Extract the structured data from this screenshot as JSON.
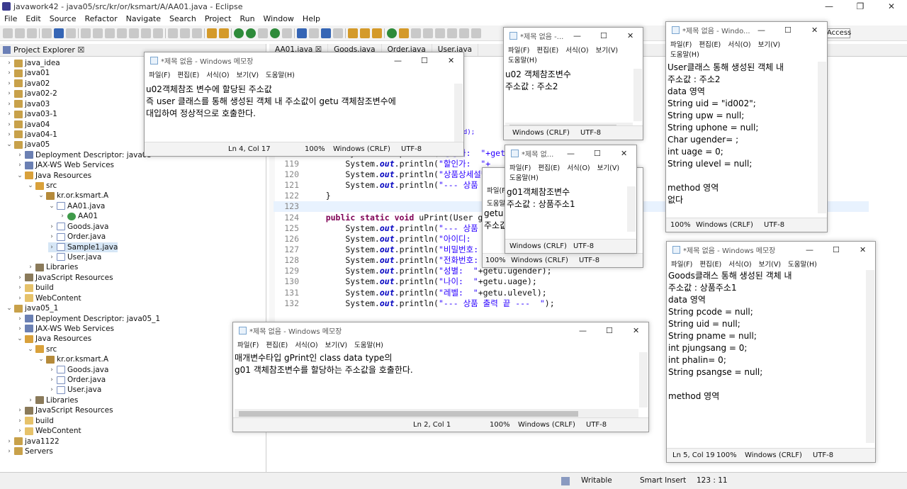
{
  "window": {
    "title": "javawork42 - java05/src/kr/or/ksmart/A/AA01.java - Eclipse"
  },
  "menu": [
    "File",
    "Edit",
    "Source",
    "Refactor",
    "Navigate",
    "Search",
    "Project",
    "Run",
    "Window",
    "Help"
  ],
  "toolbar": {
    "quick_access": "Access"
  },
  "explorer": {
    "title": "Project Explorer ☒"
  },
  "tree": [
    {
      "t": "java_idea",
      "d": 0,
      "tw": "›",
      "ic": "proj"
    },
    {
      "t": "java01",
      "d": 0,
      "tw": "›",
      "ic": "proj"
    },
    {
      "t": "java02",
      "d": 0,
      "tw": "›",
      "ic": "proj"
    },
    {
      "t": "java02-2",
      "d": 0,
      "tw": "›",
      "ic": "proj"
    },
    {
      "t": "java03",
      "d": 0,
      "tw": "›",
      "ic": "proj"
    },
    {
      "t": "java03-1",
      "d": 0,
      "tw": "›",
      "ic": "proj"
    },
    {
      "t": "java04",
      "d": 0,
      "tw": "›",
      "ic": "proj"
    },
    {
      "t": "java04-1",
      "d": 0,
      "tw": "›",
      "ic": "proj"
    },
    {
      "t": "java05",
      "d": 0,
      "tw": "⌄",
      "ic": "proj"
    },
    {
      "t": "Deployment Descriptor: java05",
      "d": 1,
      "tw": "›",
      "ic": "cfg"
    },
    {
      "t": "JAX-WS Web Services",
      "d": 1,
      "tw": "›",
      "ic": "cfg"
    },
    {
      "t": "Java Resources",
      "d": 1,
      "tw": "⌄",
      "ic": "src"
    },
    {
      "t": "src",
      "d": 2,
      "tw": "⌄",
      "ic": "src"
    },
    {
      "t": "kr.or.ksmart.A",
      "d": 3,
      "tw": "⌄",
      "ic": "pkg"
    },
    {
      "t": "AA01.java",
      "d": 4,
      "tw": "⌄",
      "ic": "java"
    },
    {
      "t": "AA01",
      "d": 5,
      "tw": "›",
      "ic": "cls"
    },
    {
      "t": "Goods.java",
      "d": 4,
      "tw": "›",
      "ic": "java"
    },
    {
      "t": "Order.java",
      "d": 4,
      "tw": "›",
      "ic": "java"
    },
    {
      "t": "Sample1.java",
      "d": 4,
      "tw": "›",
      "ic": "java",
      "sel": true
    },
    {
      "t": "User.java",
      "d": 4,
      "tw": "›",
      "ic": "java"
    },
    {
      "t": "Libraries",
      "d": 2,
      "tw": "›",
      "ic": "lib"
    },
    {
      "t": "JavaScript Resources",
      "d": 1,
      "tw": "›",
      "ic": "lib"
    },
    {
      "t": "build",
      "d": 1,
      "tw": "›",
      "ic": "fold"
    },
    {
      "t": "WebContent",
      "d": 1,
      "tw": "›",
      "ic": "fold"
    },
    {
      "t": "java05_1",
      "d": 0,
      "tw": "⌄",
      "ic": "proj"
    },
    {
      "t": "Deployment Descriptor: java05_1",
      "d": 1,
      "tw": "›",
      "ic": "cfg"
    },
    {
      "t": "JAX-WS Web Services",
      "d": 1,
      "tw": "›",
      "ic": "cfg"
    },
    {
      "t": "Java Resources",
      "d": 1,
      "tw": "⌄",
      "ic": "src"
    },
    {
      "t": "src",
      "d": 2,
      "tw": "⌄",
      "ic": "src"
    },
    {
      "t": "kr.or.ksmart.A",
      "d": 3,
      "tw": "⌄",
      "ic": "pkg"
    },
    {
      "t": "Goods.java",
      "d": 4,
      "tw": "›",
      "ic": "java"
    },
    {
      "t": "Order.java",
      "d": 4,
      "tw": "›",
      "ic": "java"
    },
    {
      "t": "User.java",
      "d": 4,
      "tw": "›",
      "ic": "java"
    },
    {
      "t": "Libraries",
      "d": 2,
      "tw": "›",
      "ic": "lib"
    },
    {
      "t": "JavaScript Resources",
      "d": 1,
      "tw": "›",
      "ic": "lib"
    },
    {
      "t": "build",
      "d": 1,
      "tw": "›",
      "ic": "fold"
    },
    {
      "t": "WebContent",
      "d": 1,
      "tw": "›",
      "ic": "fold"
    },
    {
      "t": "java1122",
      "d": 0,
      "tw": "›",
      "ic": "proj"
    },
    {
      "t": "Servers",
      "d": 0,
      "tw": "›",
      "ic": "proj"
    }
  ],
  "editor_tabs": [
    "AA01.java ☒",
    "Goods.java",
    "Order.java",
    "User.java"
  ],
  "code": [
    {
      "n": "",
      "seg": [
        [
          "t",
          "                         "
        ],
        [
          "kr",
          "ods getg"
        ]
      ]
    },
    {
      "n": "",
      "seg": [
        [
          "t",
          "                         "
        ],
        [
          "s",
          "\"+getg"
        ]
      ]
    },
    {
      "n": "",
      "seg": [
        [
          "t",
          "                         "
        ],
        [
          "kr",
          "\"+getg.uid);"
        ]
      ]
    },
    {
      "n": "117",
      "seg": [
        [
          "t",
          "                         "
        ],
        [
          "s",
          "\"+getg."
        ]
      ]
    },
    {
      "n": "118",
      "seg": [
        [
          "t",
          "        System."
        ],
        [
          "f",
          "out"
        ],
        [
          "t",
          ".println("
        ],
        [
          "s",
          "\"정상가:  \"+getg."
        ]
      ]
    },
    {
      "n": "119",
      "seg": [
        [
          "t",
          "        System."
        ],
        [
          "f",
          "out"
        ],
        [
          "t",
          ".println("
        ],
        [
          "s",
          "\"할인가:  \"+"
        ]
      ]
    },
    {
      "n": "120",
      "seg": [
        [
          "t",
          "        System."
        ],
        [
          "f",
          "out"
        ],
        [
          "t",
          ".println("
        ],
        [
          "s",
          "\"상품상세설명"
        ]
      ]
    },
    {
      "n": "121",
      "seg": [
        [
          "t",
          "        System."
        ],
        [
          "f",
          "out"
        ],
        [
          "t",
          ".println("
        ],
        [
          "s",
          "\"--- 상품 "
        ]
      ]
    },
    {
      "n": "122",
      "seg": [
        [
          "t",
          "    }"
        ]
      ]
    },
    {
      "n": "123",
      "seg": [
        [
          "t",
          ""
        ]
      ]
    },
    {
      "n": "124",
      "seg": [
        [
          "t",
          "    "
        ],
        [
          "k",
          "public static void"
        ],
        [
          "t",
          " uPrint(User g"
        ]
      ]
    },
    {
      "n": "125",
      "seg": [
        [
          "t",
          "        System."
        ],
        [
          "f",
          "out"
        ],
        [
          "t",
          ".println("
        ],
        [
          "s",
          "\"--- 상품 출"
        ]
      ]
    },
    {
      "n": "126",
      "seg": [
        [
          "t",
          "        System."
        ],
        [
          "f",
          "out"
        ],
        [
          "t",
          ".println("
        ],
        [
          "s",
          "\"아이디:  \""
        ],
        [
          "t",
          "+"
        ]
      ]
    },
    {
      "n": "127",
      "seg": [
        [
          "t",
          "        System."
        ],
        [
          "f",
          "out"
        ],
        [
          "t",
          ".println("
        ],
        [
          "s",
          "\"비밀번호:  \""
        ]
      ]
    },
    {
      "n": "128",
      "seg": [
        [
          "t",
          "        System."
        ],
        [
          "f",
          "out"
        ],
        [
          "t",
          ".println("
        ],
        [
          "s",
          "\"전화번호:  \""
        ],
        [
          "t",
          "+getu.uphone);"
        ]
      ]
    },
    {
      "n": "129",
      "seg": [
        [
          "t",
          "        System."
        ],
        [
          "f",
          "out"
        ],
        [
          "t",
          ".println("
        ],
        [
          "s",
          "\"성별:  \""
        ],
        [
          "t",
          "+getu.ugender);"
        ]
      ]
    },
    {
      "n": "130",
      "seg": [
        [
          "t",
          "        System."
        ],
        [
          "f",
          "out"
        ],
        [
          "t",
          ".println("
        ],
        [
          "s",
          "\"나이:  \""
        ],
        [
          "t",
          "+getu.uage);"
        ]
      ]
    },
    {
      "n": "131",
      "seg": [
        [
          "t",
          "        System."
        ],
        [
          "f",
          "out"
        ],
        [
          "t",
          ".println("
        ],
        [
          "s",
          "\"레벨:  \""
        ],
        [
          "t",
          "+getu.ulevel);"
        ]
      ]
    },
    {
      "n": "132",
      "seg": [
        [
          "t",
          "        System."
        ],
        [
          "f",
          "out"
        ],
        [
          "t",
          ".println("
        ],
        [
          "s",
          "\"--- 상품 출력 끝 ---  \""
        ],
        [
          "t",
          ");"
        ]
      ]
    }
  ],
  "statusbar": {
    "mode": "Writable",
    "insert": "Smart Insert",
    "pos": "123 : 11"
  },
  "notepads": [
    {
      "id": "np1",
      "title": "*제목 없음 - Windows 메모장",
      "menu": [
        "파일(F)",
        "편집(E)",
        "서식(O)",
        "보기(V)",
        "도움말(H)"
      ],
      "body": "u02객체참조 변수에 할당된 주소값\n즉 user 클래스를 통해 생성된 객체 내 주소값이 getu 객체참조변수에\n대입하여 정상적으로 호출한다.",
      "status": [
        "Ln 4, Col 17",
        "100%",
        "Windows (CRLF)",
        "UTF-8"
      ]
    },
    {
      "id": "np2",
      "title": "*제목 없음 -...",
      "menu": [
        "파일(F)",
        "편집(E)",
        "서식(O)",
        "보기(V)",
        "도움말(H)"
      ],
      "body": "u02 객체참조변수\n주소값 : 주소2",
      "status": [
        "Windows (CRLF)",
        "UTF-8"
      ]
    },
    {
      "id": "np3",
      "title": "*제목 없음 - Windo...",
      "menu": [
        "파일(F)",
        "편집(E)",
        "서식(O)",
        "보기(V)",
        "도움말(H)"
      ],
      "body": "User클래스 통해 생성된 객체 내\n주소값 : 주소2\ndata 영역\nString uid = \"id002\";\nString upw = null;\nString uphone = null;\nChar ugender= ;\nint uage = 0;\nString ulevel = null;\n\nmethod 영역\n없다",
      "status": [
        "100%",
        "Windows (CRLF)",
        "UTF-8"
      ]
    },
    {
      "id": "np4",
      "title": "*제목 없...",
      "menu": [
        "파일(F)",
        "편집(E)",
        "서식(O)",
        "보기(V)",
        "도움말(H)"
      ],
      "body": "g01객체참조변수\n주소값 : 상품주소1",
      "status": [
        "Windows (CRLF)",
        "UTF-8"
      ]
    },
    {
      "id": "np5",
      "title": "*제목 없음 - Windows 메모장",
      "menu": [
        "파일(F)",
        "편집(E)",
        "서식(O)",
        "보기(V)",
        "도움말(H)"
      ],
      "body": "Goods클래스 통해 생성된 객체 내\n주소값 : 상품주소1\ndata 영역\nString pcode = null;\nString uid = null;\nString pname = null;\nint pjungsang = 0;\nint phalin= 0;\nString psangse = null;\n\nmethod 영역",
      "status": [
        "Ln 5, Col 19",
        "100%",
        "Windows (CRLF)",
        "UTF-8"
      ]
    },
    {
      "id": "np6",
      "title": "*제목 없음 - Windows 메모장",
      "menu": [
        "파일(F)",
        "편집(E)",
        "서식(O)",
        "보기(V)",
        "도움말(H)"
      ],
      "body": "매개변수타입 gPrint인 class data type의\ng01 객체참조변수를 할당하는 주소값을 호출한다.",
      "status": [
        "Ln 2, Col 1",
        "100%",
        "Windows (CRLF)",
        "UTF-8"
      ]
    }
  ],
  "hidden_np": {
    "menu1": "파일(F)",
    "menu2": "도움말(H)",
    "body": "getu\n주소값",
    "status": [
      "100%",
      "Windows (CRLF)",
      "UTF-8"
    ]
  }
}
